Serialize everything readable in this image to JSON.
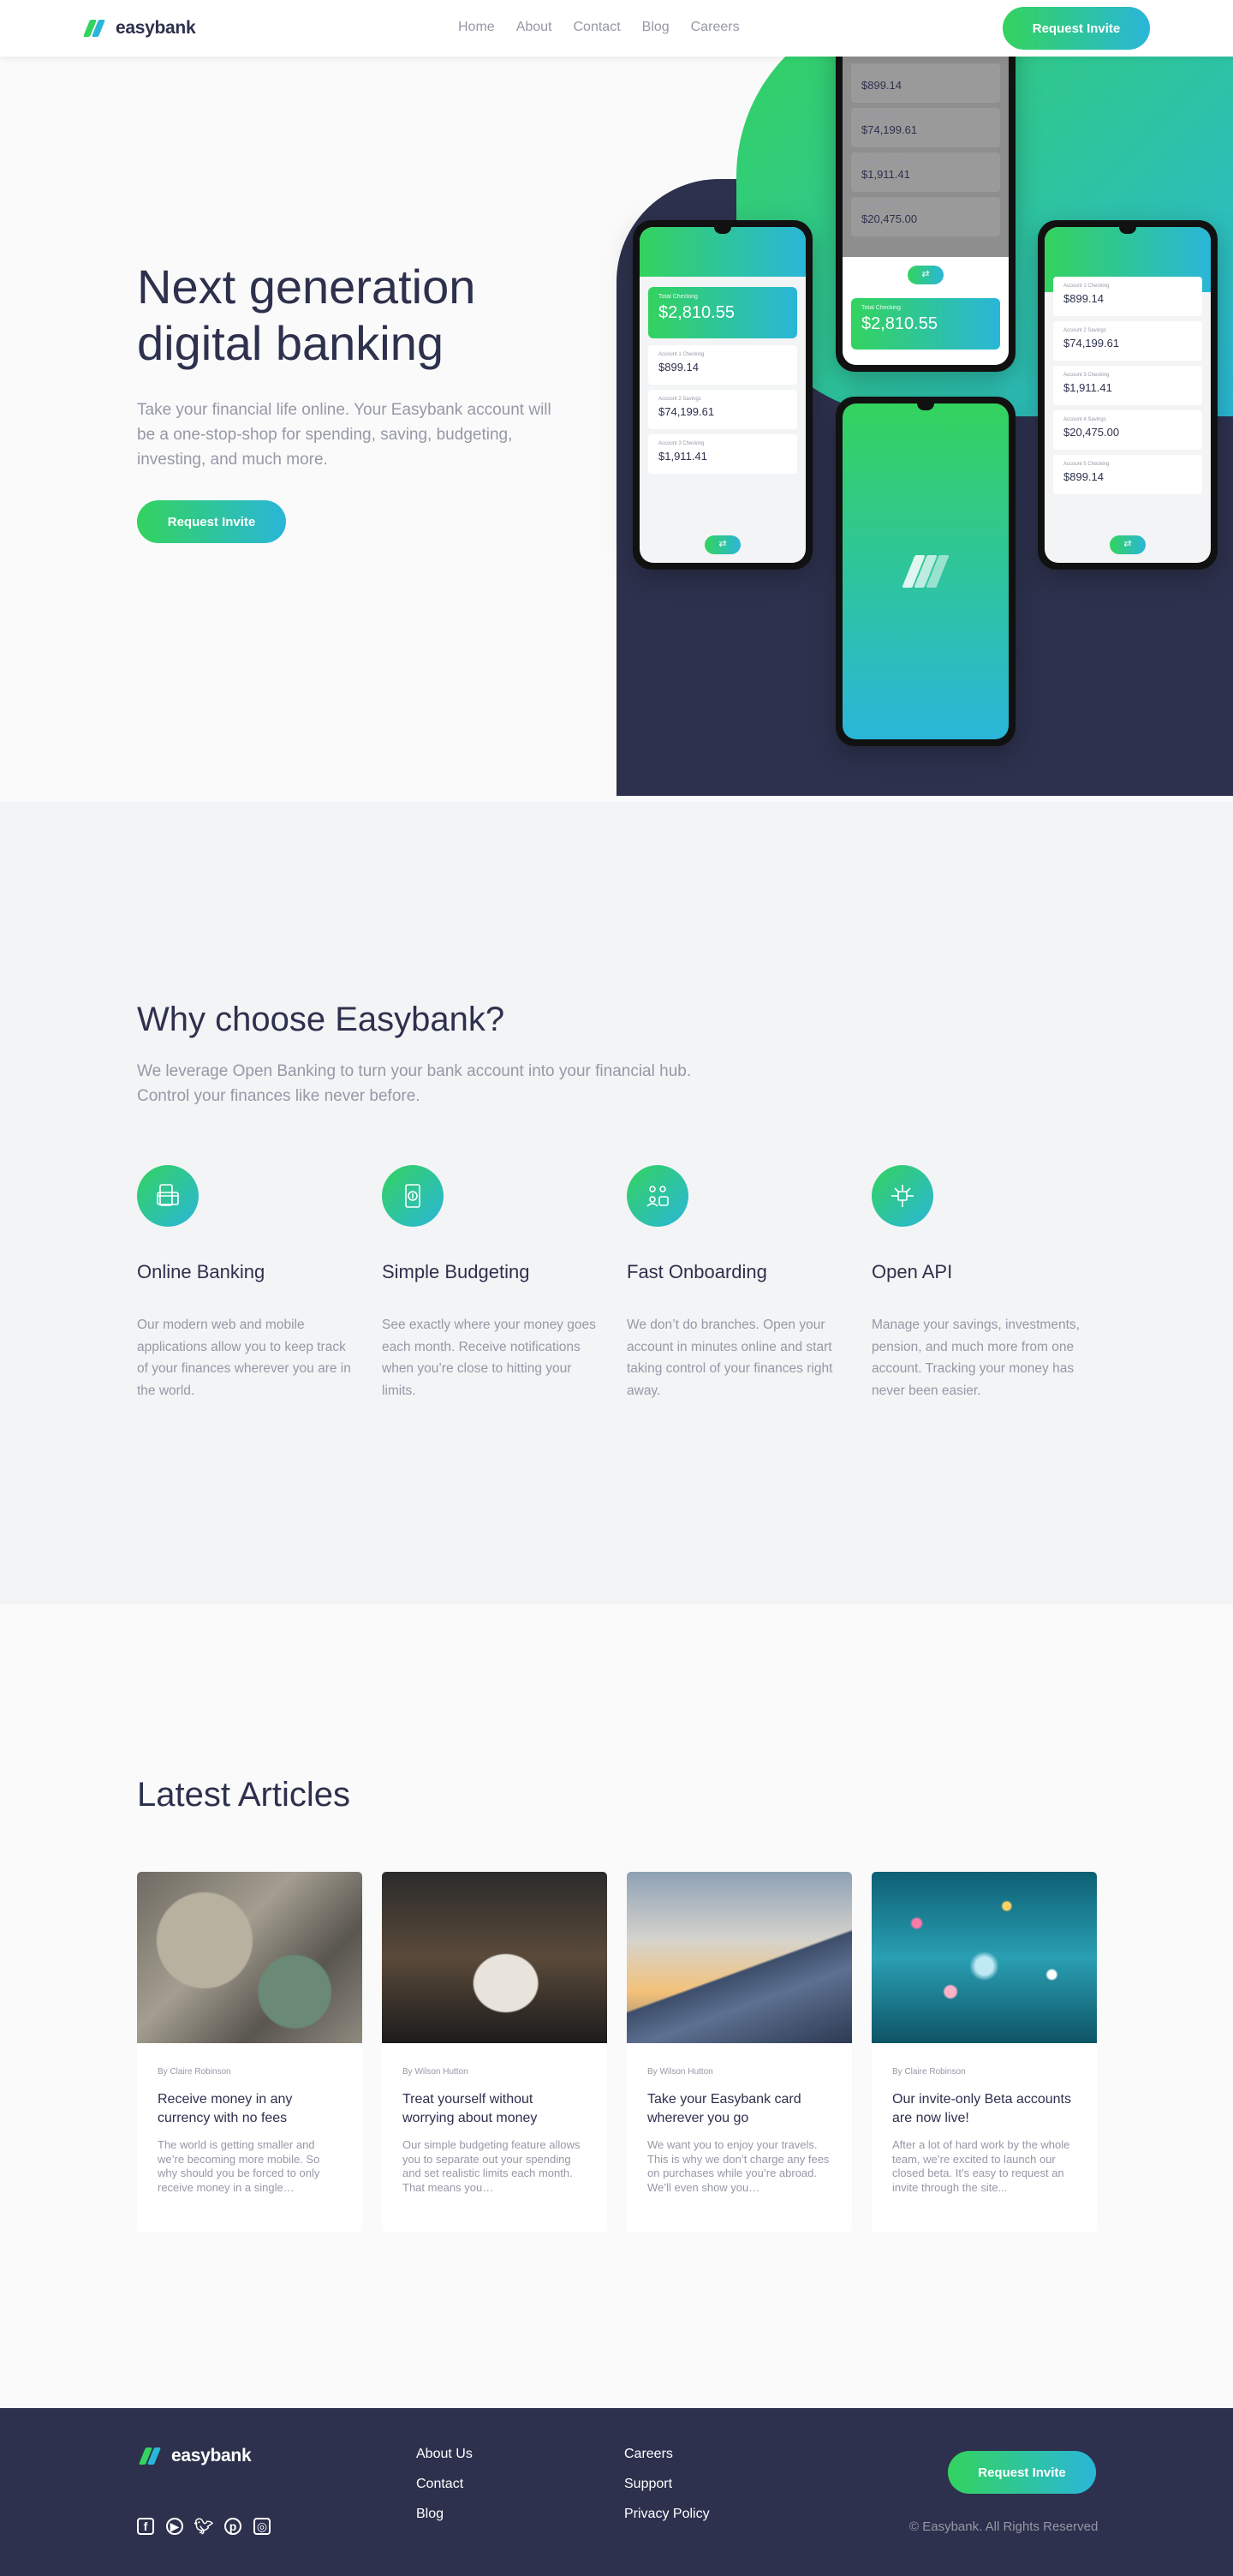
{
  "brand": {
    "name": "easybank"
  },
  "nav": {
    "items": [
      "Home",
      "About",
      "Contact",
      "Blog",
      "Careers"
    ]
  },
  "cta": {
    "label": "Request Invite"
  },
  "hero": {
    "title": "Next generation digital banking",
    "description": "Take your financial life online. Your Easybank account will be a one-stop-shop for spending, saving, budgeting, investing, and much more."
  },
  "mockup": {
    "total_label": "Total Checking",
    "total_value": "$2,810.55",
    "accounts": [
      {
        "label": "Account 1 Checking",
        "value": "$899.14"
      },
      {
        "label": "Account 2 Savings",
        "value": "$74,199.61"
      },
      {
        "label": "Account 3 Checking",
        "value": "$1,911.41"
      },
      {
        "label": "Account 4 Savings",
        "value": "$20,475.00"
      },
      {
        "label": "Account 5 Checking",
        "value": "$899.14"
      }
    ]
  },
  "why": {
    "title": "Why choose Easybank?",
    "intro": "We leverage Open Banking to turn your bank account into your financial hub. Control your finances like never before.",
    "features": [
      {
        "icon": "online-banking-icon",
        "title": "Online Banking",
        "text": "Our modern web and mobile applications allow you to keep track of your finances wherever you are in the world."
      },
      {
        "icon": "budgeting-icon",
        "title": "Simple Budgeting",
        "text": "See exactly where your money goes each month. Receive notifications when you’re close to hitting your limits."
      },
      {
        "icon": "onboarding-icon",
        "title": "Fast Onboarding",
        "text": "We don’t do branches. Open your account in minutes online and start taking control of your finances right away."
      },
      {
        "icon": "api-icon",
        "title": "Open API",
        "text": "Manage your savings, investments, pension, and much more from one account. Tracking your money has never been easier."
      }
    ]
  },
  "articles": {
    "title": "Latest Articles",
    "items": [
      {
        "author": "By Claire Robinson",
        "title": "Receive money in any currency with no fees",
        "excerpt": "The world is getting smaller and we’re becoming more mobile. So why should you be forced to only receive money in a single…"
      },
      {
        "author": "By Wilson Hutton",
        "title": "Treat yourself without worrying about money",
        "excerpt": "Our simple budgeting feature allows you to separate out your spending and set realistic limits each month. That means you…"
      },
      {
        "author": "By Wilson Hutton",
        "title": "Take your Easybank card wherever you go",
        "excerpt": "We want you to enjoy your travels. This is why we don’t charge any fees on purchases while you’re abroad. We’ll even show you…"
      },
      {
        "author": "By Claire Robinson",
        "title": "Our invite-only Beta accounts are now live!",
        "excerpt": "After a lot of hard work by the whole team, we’re excited to launch our closed beta. It’s easy to request an invite through the site..."
      }
    ]
  },
  "footer": {
    "col1": [
      "About Us",
      "Contact",
      "Blog"
    ],
    "col2": [
      "Careers",
      "Support",
      "Privacy Policy"
    ],
    "copyright": "© Easybank. All Rights Reserved",
    "socials": [
      "facebook-icon",
      "youtube-icon",
      "twitter-icon",
      "pinterest-icon",
      "instagram-icon"
    ]
  },
  "colors": {
    "dark_blue": "#2d314d",
    "lime_green": "#33d35e",
    "bright_cyan": "#2ab6d9",
    "grayish_blue": "#9698a6"
  }
}
